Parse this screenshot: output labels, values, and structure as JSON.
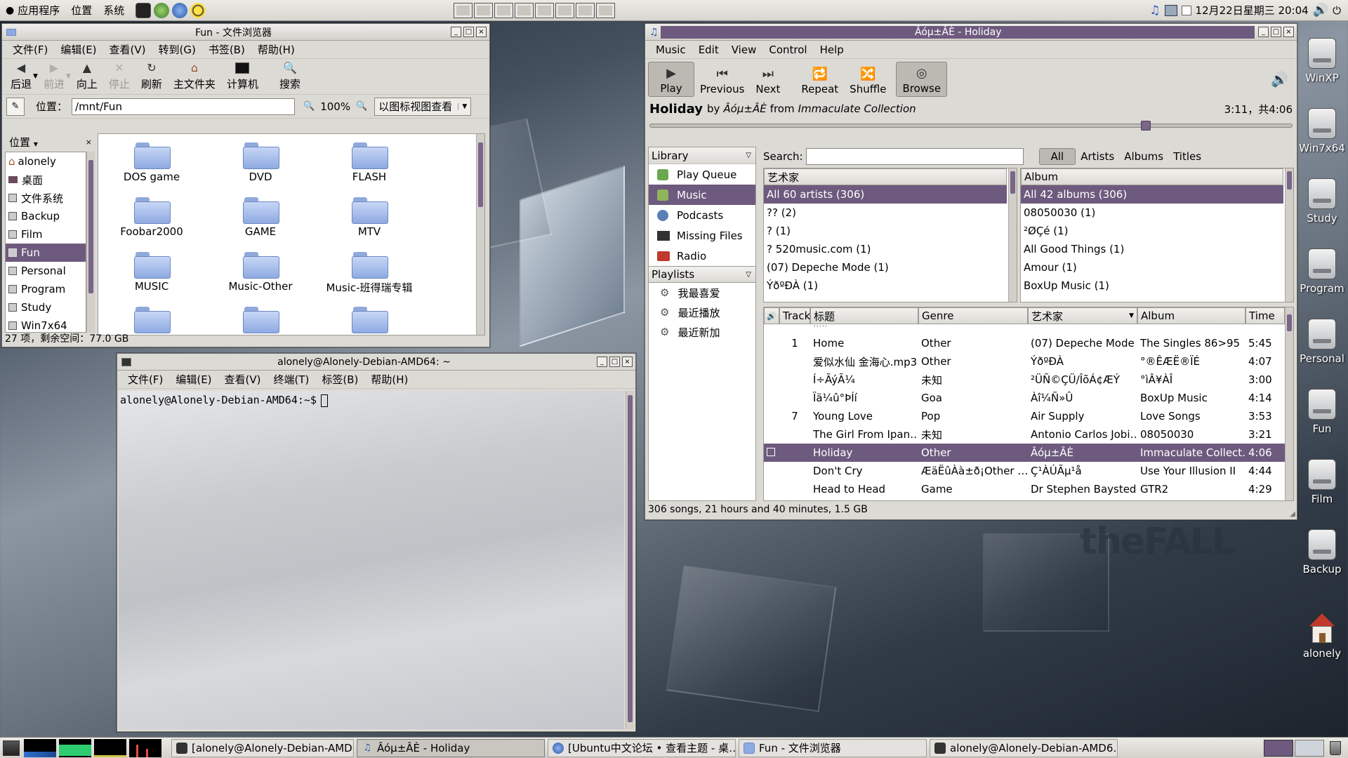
{
  "top_panel": {
    "menus": [
      "应用程序",
      "位置",
      "系统"
    ],
    "clock": "12月22日星期三 20:04"
  },
  "file_browser": {
    "title": "Fun - 文件浏览器",
    "menus": [
      "文件(F)",
      "编辑(E)",
      "查看(V)",
      "转到(G)",
      "书签(B)",
      "帮助(H)"
    ],
    "toolbar": {
      "back": "后退",
      "forward": "前进",
      "up": "向上",
      "stop": "停止",
      "reload": "刷新",
      "home": "主文件夹",
      "computer": "计算机",
      "search": "搜索"
    },
    "location_label": "位置：",
    "location_value": "/mnt/Fun",
    "zoom": "100%",
    "view_mode": "以图标视图查看",
    "side_header": "位置",
    "places": [
      "alonely",
      "桌面",
      "文件系统",
      "Backup",
      "Film",
      "Fun",
      "Personal",
      "Program",
      "Study",
      "Win7x64"
    ],
    "selected_place": "Fun",
    "folders": [
      "DOS game",
      "DVD",
      "FLASH",
      "Foobar2000",
      "GAME",
      "MTV",
      "MUSIC",
      "Music-Other",
      "Music-班得瑞专辑"
    ],
    "status": "27 项，剩余空间：77.0 GB"
  },
  "terminal": {
    "title": "alonely@Alonely-Debian-AMD64: ~",
    "menus": [
      "文件(F)",
      "编辑(E)",
      "查看(V)",
      "终端(T)",
      "标签(B)",
      "帮助(H)"
    ],
    "prompt": "alonely@Alonely-Debian-AMD64:~$"
  },
  "rhythmbox": {
    "title": "Âóµ±ÂÈ - Holiday",
    "menus": [
      "Music",
      "Edit",
      "View",
      "Control",
      "Help"
    ],
    "buttons": {
      "play": "Play",
      "previous": "Previous",
      "next": "Next",
      "repeat": "Repeat",
      "shuffle": "Shuffle",
      "browse": "Browse"
    },
    "now_playing": {
      "title": "Holiday",
      "by": "by",
      "artist": "Âóµ±ÂÈ",
      "from": "from",
      "album": "Immaculate Collection",
      "time": "3:11，共4:06",
      "progress": 0.776
    },
    "library_header": "Library",
    "library_items": [
      "Play Queue",
      "Music",
      "Podcasts",
      "Missing Files",
      "Radio"
    ],
    "selected_source": "Music",
    "playlists_header": "Playlists",
    "playlists": [
      "我最喜爱",
      "最近播放",
      "最近新加"
    ],
    "search_label": "Search:",
    "search_value": "",
    "filter_buttons": [
      "All",
      "Artists",
      "Albums",
      "Titles"
    ],
    "artist_header": "艺术家",
    "artists": [
      "All 60 artists (306)",
      "?? (2)",
      "? (1)",
      "? 520music.com (1)",
      "(07) Depeche Mode (1)",
      "ÝðºÐÀ (1)"
    ],
    "album_header": "Album",
    "albums": [
      "All 42 albums (306)",
      "08050030 (1)",
      "²ØÇé (1)",
      "All Good Things (1)",
      "Amour (1)",
      "BoxUp Music (1)"
    ],
    "columns": [
      "Track",
      "标题",
      "Genre",
      "艺术家",
      "Album",
      "Time"
    ],
    "songs": [
      {
        "track": "1",
        "title": "Home",
        "genre": "Other",
        "artist": "(07) Depeche Mode",
        "album": "The Singles 86>95",
        "time": "5:45"
      },
      {
        "track": "",
        "title": "爱似水仙 金海心.mp3",
        "genre": "Other",
        "artist": "ÝðºÐÀ",
        "album": "°®ÊÆË®ÏÉ",
        "time": "4:07"
      },
      {
        "track": "",
        "title": "Í÷ÃýÃ¼",
        "genre": "未知",
        "artist": "²ÜÑ©ÇÜ/ÎõÁ¢ÆÝ",
        "album": "°ìÂ¥ÀÎ",
        "time": "3:00"
      },
      {
        "track": "",
        "title": "Ïä¼û°ÞÍí",
        "genre": "Goa",
        "artist": "Àî¼Ñ»Û",
        "album": "BoxUp Music",
        "time": "4:14"
      },
      {
        "track": "7",
        "title": "Young Love",
        "genre": "Pop",
        "artist": "Air Supply",
        "album": "Love Songs",
        "time": "3:53"
      },
      {
        "track": "",
        "title": "The Girl From Ipan…",
        "genre": "未知",
        "artist": "Antonio Carlos Jobi…",
        "album": "08050030",
        "time": "3:21"
      },
      {
        "track": "",
        "title": "Holiday",
        "genre": "Other",
        "artist": "Âóµ±ÂÈ",
        "album": "Immaculate Collect…",
        "time": "4:06"
      },
      {
        "track": "",
        "title": "Don't Cry",
        "genre": "ÆäËûÀà±ð¡Other …",
        "artist": "Ç¹ÀÚÃµ¹å",
        "album": "Use Your Illusion II",
        "time": "4:44"
      },
      {
        "track": "",
        "title": "Head to Head",
        "genre": "Game",
        "artist": "Dr Stephen Baysted",
        "album": "GTR2",
        "time": "4:29"
      }
    ],
    "playing_index": 6,
    "status": "306 songs, 21 hours and 40 minutes, 1.5 GB"
  },
  "desktop_icons": [
    "WinXP",
    "Win7x64",
    "Study",
    "Program",
    "Personal",
    "Fun",
    "Film",
    "Backup",
    "alonely"
  ],
  "wallpaper_text": "theFALL",
  "taskbar": {
    "tasks": [
      "[alonely@Alonely-Debian-AMD6…",
      "Âóµ±ÂÈ - Holiday",
      "[Ubuntu中文论坛 • 查看主题 - 桌…",
      "Fun - 文件浏览器",
      "alonely@Alonely-Debian-AMD6…"
    ],
    "active_task": "Âóµ±ÂÈ - Holiday"
  }
}
